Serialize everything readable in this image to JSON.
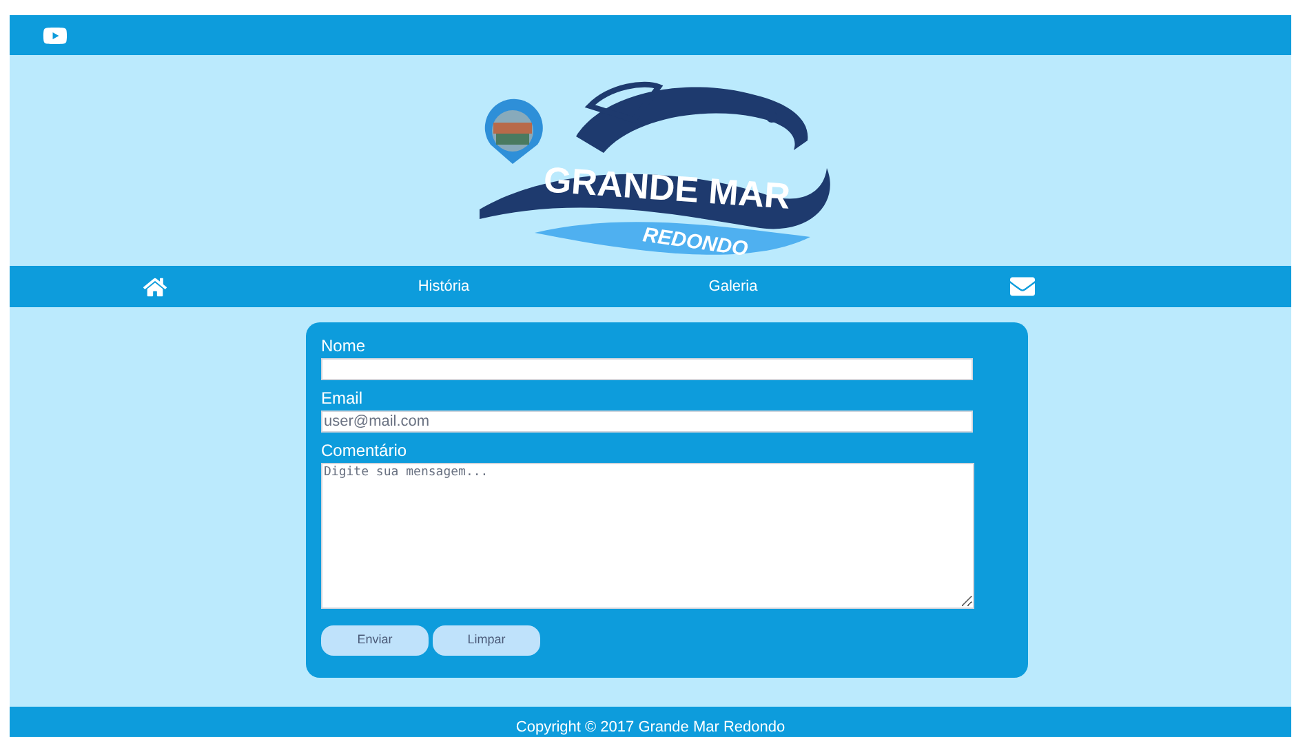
{
  "logo": {
    "title": "GRANDE MAR",
    "subtitle": "REDONDO"
  },
  "nav": [
    {
      "kind": "home"
    },
    {
      "kind": "link",
      "label": "História"
    },
    {
      "kind": "link",
      "label": "Galeria"
    },
    {
      "kind": "mail"
    }
  ],
  "form": {
    "fields": [
      {
        "kind": "input",
        "label": "Nome"
      },
      {
        "kind": "input",
        "label": "Email",
        "placeholder": "user@mail.com"
      },
      {
        "kind": "textarea",
        "label": "Comentário",
        "placeholder": "Digite sua mensagem..."
      }
    ],
    "buttons": [
      "Enviar",
      "Limpar"
    ]
  },
  "footer": {
    "text": "Copyright © 2017 Grande Mar Redondo"
  }
}
